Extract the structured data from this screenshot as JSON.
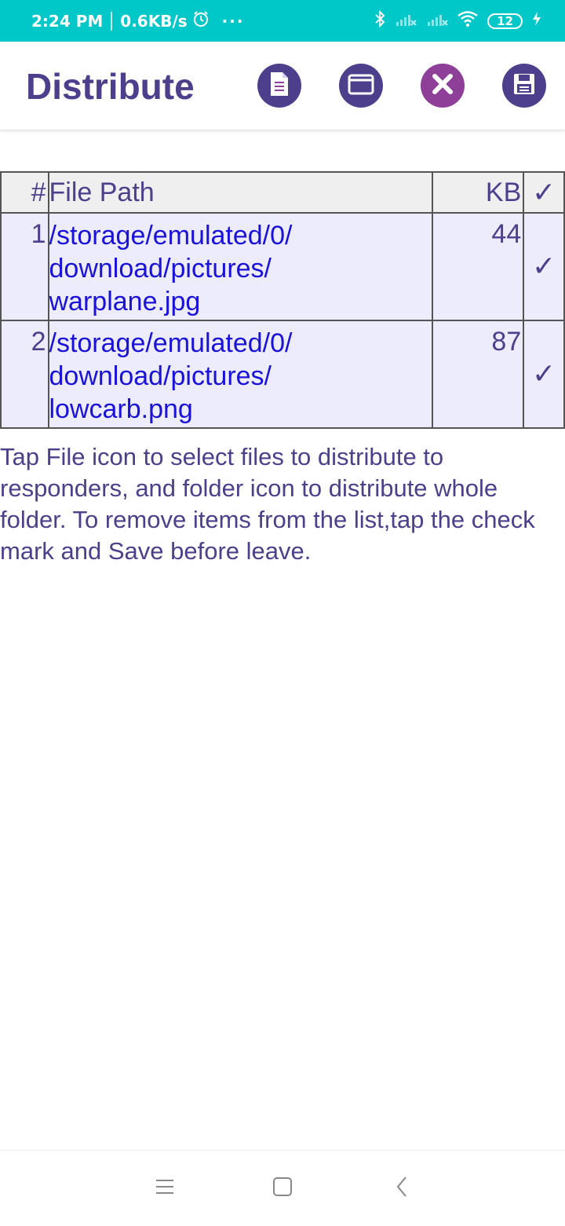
{
  "status_bar": {
    "time": "2:24 PM",
    "speed": "0.6KB/s",
    "battery": "12",
    "icons": [
      "alarm-icon",
      "more-dots-icon",
      "bluetooth-icon",
      "signal-icon",
      "signal-icon",
      "wifi-icon",
      "battery-icon",
      "charging-icon"
    ]
  },
  "app_bar": {
    "title": "Distribute",
    "actions": [
      "file-icon",
      "folder-icon",
      "delete-icon",
      "save-icon"
    ]
  },
  "table": {
    "headers": {
      "num": "#",
      "path": "File Path",
      "kb": "KB",
      "check": "✓"
    },
    "rows": [
      {
        "num": "1",
        "path_lines": [
          "/storage/emulated/0/",
          "download/pictures/",
          "warplane.jpg"
        ],
        "kb": "44",
        "check": "✓"
      },
      {
        "num": "2",
        "path_lines": [
          "/storage/emulated/0/",
          "download/pictures/",
          "lowcarb.png"
        ],
        "kb": "87",
        "check": "✓"
      }
    ]
  },
  "help_text": "Tap File icon to select files to distribute to responders, and folder icon to distribute whole folder. To remove items from the list,tap the check mark and Save before leave.",
  "colors": {
    "status_bar": "#00C8C8",
    "primary": "#4E3F8C",
    "delete": "#8E3F98",
    "link": "#1A12D8",
    "row_bg": "#EDECFC",
    "header_bg": "#EFEFEF"
  }
}
